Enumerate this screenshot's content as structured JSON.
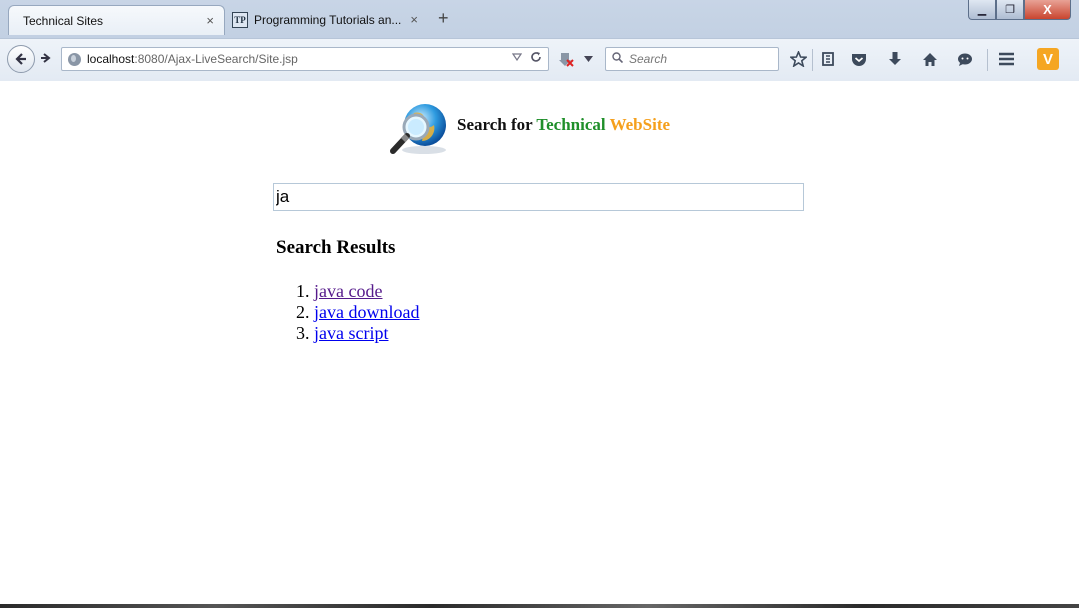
{
  "browser": {
    "tabs": [
      {
        "label": "Technical Sites",
        "active": true
      },
      {
        "label": "Programming Tutorials an...",
        "active": false
      }
    ],
    "close_glyph": "×",
    "new_tab_glyph": "+",
    "window_controls": {
      "minimize": "▁",
      "maximize": "❐",
      "close": "X"
    },
    "url": {
      "host": "localhost",
      "path": ":8080/Ajax-LiveSearch/Site.jsp"
    },
    "url_right_icons": [
      "dropdown-arrow-icon",
      "reload-icon"
    ],
    "search_placeholder": "Search",
    "toolbar_icons": [
      "bookmark-star-icon",
      "reading-list-icon",
      "pocket-icon",
      "download-icon",
      "home-icon",
      "chat-icon",
      "menu-icon",
      "vivaldi-icon"
    ]
  },
  "page": {
    "heading": {
      "prefix": "Search for",
      "green_word": "Technical",
      "orange_word": "WebSite"
    },
    "search_value": "ja",
    "results_title": "Search Results",
    "results": [
      {
        "label": "java code",
        "visited": true
      },
      {
        "label": "java download",
        "visited": false
      },
      {
        "label": "java script",
        "visited": false
      }
    ]
  },
  "colors": {
    "green": "#1f8f2a",
    "orange": "#f5a01d",
    "link": "#0000ee",
    "visited_link": "#551a8b"
  }
}
